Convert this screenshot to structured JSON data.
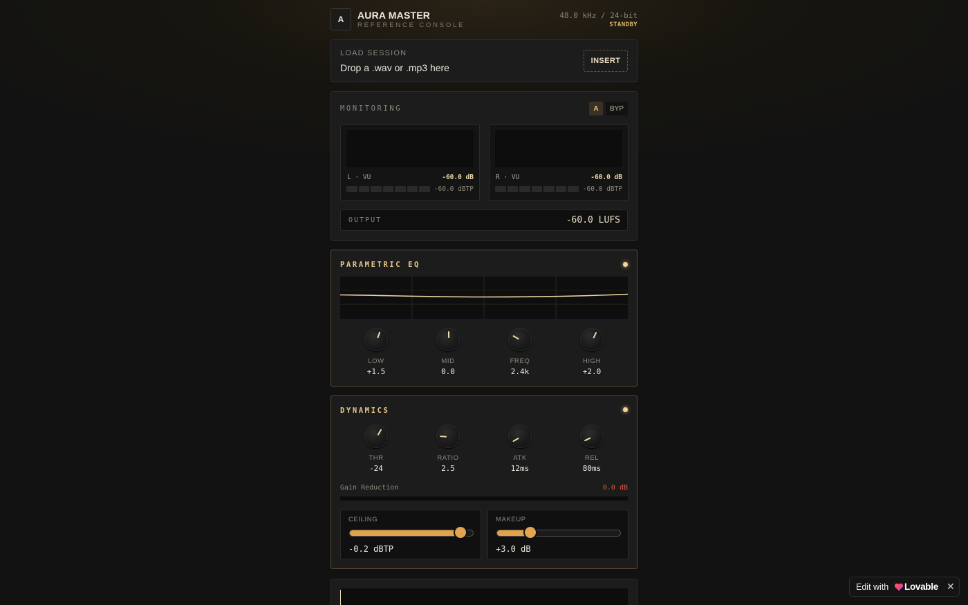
{
  "header": {
    "logo_letter": "A",
    "title": "AURA MASTER",
    "subtitle": "REFERENCE CONSOLE",
    "sample_rate": "48.0 kHz / 24-bit",
    "status": "STANDBY"
  },
  "load": {
    "label": "LOAD SESSION",
    "hint": "Drop a .wav or .mp3 here",
    "insert_label": "INSERT"
  },
  "monitoring": {
    "title": "MONITORING",
    "ab_a": "A",
    "ab_bypass": "BYP",
    "meters": [
      {
        "channel": "L · VU",
        "db": "-60.0 dB",
        "true_peak": "-60.0 dBTP"
      },
      {
        "channel": "R · VU",
        "db": "-60.0 dB",
        "true_peak": "-60.0 dBTP"
      }
    ],
    "output": {
      "label": "OUTPUT",
      "value": "-60.0 LUFS"
    }
  },
  "eq": {
    "title": "PARAMETRIC EQ",
    "knobs": [
      {
        "label": "LOW",
        "value": "+1.5",
        "angle": 20
      },
      {
        "label": "MID",
        "value": "0.0",
        "angle": 0
      },
      {
        "label": "FREQ",
        "value": "2.4k",
        "angle": -60
      },
      {
        "label": "HIGH",
        "value": "+2.0",
        "angle": 25
      }
    ]
  },
  "dynamics": {
    "title": "DYNAMICS",
    "knobs": [
      {
        "label": "THR",
        "value": "-24",
        "angle": 30
      },
      {
        "label": "RATIO",
        "value": "2.5",
        "angle": -85
      },
      {
        "label": "ATK",
        "value": "12ms",
        "angle": -120
      },
      {
        "label": "REL",
        "value": "80ms",
        "angle": -115
      }
    ],
    "gain_reduction": {
      "label": "Gain Reduction",
      "value": "0.0 dB"
    },
    "sliders": [
      {
        "label": "CEILING",
        "value": "-0.2 dBTP",
        "fraction": 0.9
      },
      {
        "label": "MAKEUP",
        "value": "+3.0 dB",
        "fraction": 0.27
      }
    ]
  },
  "badge": {
    "edit": "Edit with",
    "brand": "Lovable",
    "close": "✕"
  },
  "colors": {
    "accent": "#e0a24a",
    "gold_text": "#e6c88a",
    "danger": "#d8593f"
  }
}
